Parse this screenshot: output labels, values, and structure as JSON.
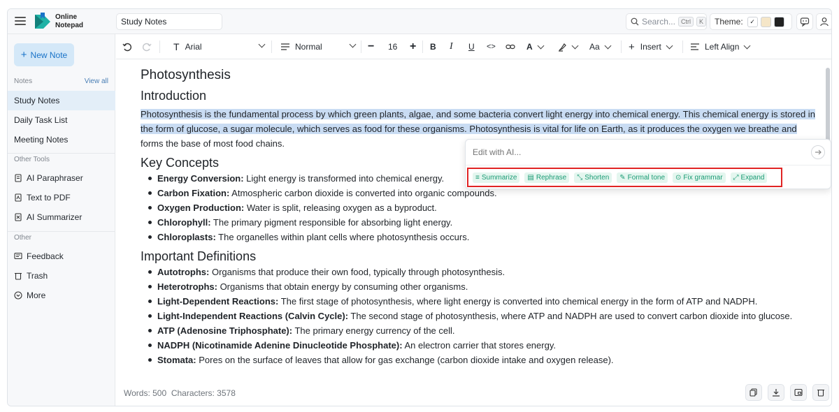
{
  "app": {
    "brand_line1": "Online",
    "brand_line2": "Notepad",
    "doc_title": "Study Notes"
  },
  "header": {
    "search_placeholder": "Search...",
    "search_kbd1": "Ctrl",
    "search_kbd2": "K",
    "theme_label": "Theme:",
    "theme_swatches": [
      "#ffffff",
      "#f5e6c8",
      "#222222"
    ],
    "accent_color": "#1a73c8"
  },
  "sidebar": {
    "new_note_label": "New Note",
    "notes_label": "Notes",
    "view_all_label": "View all",
    "notes": [
      "Study Notes",
      "Daily Task List",
      "Meeting Notes"
    ],
    "other_tools_label": "Other Tools",
    "tools": [
      {
        "label": "AI Paraphraser",
        "icon": "document-icon"
      },
      {
        "label": "Text to PDF",
        "icon": "pdf-icon"
      },
      {
        "label": "AI Summarizer",
        "icon": "summarizer-icon"
      }
    ],
    "other_label": "Other",
    "other_items": [
      {
        "label": "Feedback",
        "icon": "feedback-icon"
      },
      {
        "label": "Trash",
        "icon": "trash-icon"
      },
      {
        "label": "More",
        "icon": "more-icon"
      }
    ]
  },
  "toolbar": {
    "font_family": "Arial",
    "block_style": "Normal",
    "font_size": "16",
    "insert_label": "Insert",
    "align_label": "Left Align"
  },
  "document": {
    "title": "Photosynthesis",
    "intro_heading": "Introduction",
    "intro_line1": "Photosynthesis is the fundamental process by which green plants, algae, and some bacteria convert light energy into chemical energy. This chemical energy is stored in",
    "intro_line2": "the form of glucose, a sugar molecule, which serves as food for these organisms. Photosynthesis is vital for life on Earth, as it produces the oxygen we breathe and",
    "intro_line3": "forms the base of most food chains.",
    "concepts_heading": "Key Concepts",
    "concepts": [
      {
        "term": "Energy Conversion:",
        "text": " Light energy is transformed into chemical energy."
      },
      {
        "term": "Carbon Fixation:",
        "text": " Atmospheric carbon dioxide is converted into organic compounds."
      },
      {
        "term": "Oxygen Production:",
        "text": " Water is split, releasing oxygen as a byproduct."
      },
      {
        "term": "Chlorophyll:",
        "text": " The primary pigment responsible for absorbing light energy."
      },
      {
        "term": "Chloroplasts:",
        "text": " The organelles within plant cells where photosynthesis occurs."
      }
    ],
    "definitions_heading": "Important Definitions",
    "definitions": [
      {
        "term": "Autotrophs:",
        "text": " Organisms that produce their own food, typically through photosynthesis."
      },
      {
        "term": "Heterotrophs:",
        "text": " Organisms that obtain energy by consuming other organisms."
      },
      {
        "term": "Light-Dependent Reactions:",
        "text": " The first stage of photosynthesis, where light energy is converted into chemical energy in the form of ATP and NADPH."
      },
      {
        "term": "Light-Independent Reactions (Calvin Cycle):",
        "text": " The second stage of photosynthesis, where ATP and NADPH are used to convert carbon dioxide into glucose."
      },
      {
        "term": "ATP (Adenosine Triphosphate):",
        "text": " The primary energy currency of the cell."
      },
      {
        "term": "NADPH (Nicotinamide Adenine Dinucleotide Phosphate):",
        "text": " An electron carrier that stores energy."
      },
      {
        "term": "Stomata:",
        "text": " Pores on the surface of leaves that allow for gas exchange (carbon dioxide intake and oxygen release)."
      }
    ]
  },
  "ai_popover": {
    "placeholder": "Edit with AI...",
    "actions": [
      "Summarize",
      "Rephrase",
      "Shorten",
      "Formal tone",
      "Fix grammar",
      "Expand"
    ],
    "highlight_color": "#e02424"
  },
  "footer": {
    "words_label": "Words: 500",
    "chars_label": "Characters: 3578"
  }
}
